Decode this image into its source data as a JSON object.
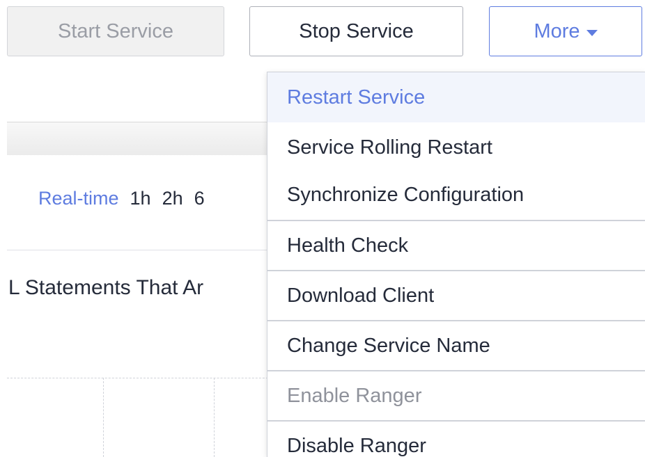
{
  "toolbar": {
    "start_label": "Start Service",
    "stop_label": "Stop Service",
    "more_label": "More"
  },
  "time_range": {
    "options": [
      "Real-time",
      "1h",
      "2h",
      "6"
    ],
    "active": "Real-time"
  },
  "chart": {
    "title": "L Statements That Ar"
  },
  "more_menu": {
    "items": [
      {
        "label": "Restart Service",
        "state": "hover"
      },
      {
        "label": "Service Rolling Restart",
        "state": "normal"
      },
      {
        "label": "Synchronize Configuration",
        "state": "normal"
      },
      {
        "label": "Health Check",
        "state": "normal"
      },
      {
        "label": "Download Client",
        "state": "normal"
      },
      {
        "label": "Change Service Name",
        "state": "normal"
      },
      {
        "label": "Enable Ranger",
        "state": "disabled"
      },
      {
        "label": "Disable Ranger",
        "state": "normal"
      }
    ]
  },
  "colors": {
    "accent": "#5e7ce0",
    "text": "#252b3a",
    "disabled_text": "#9a9da5",
    "border": "#adb0b8"
  }
}
